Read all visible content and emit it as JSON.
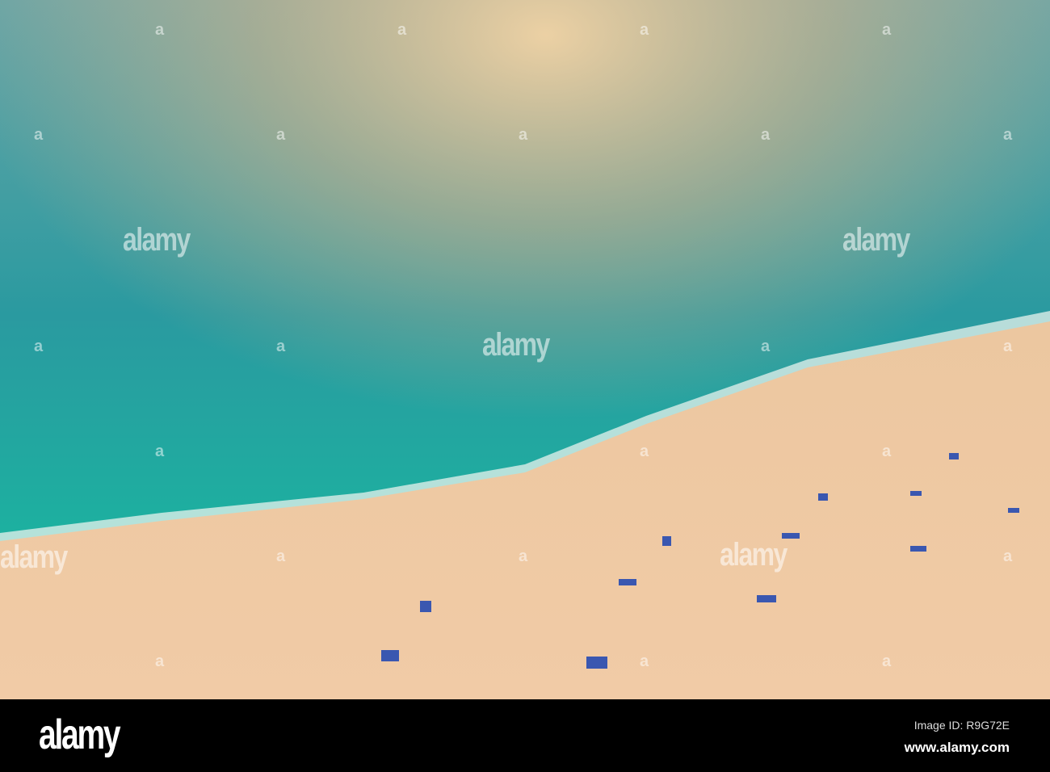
{
  "watermark": {
    "text": "alamy",
    "mark": "a"
  },
  "footer": {
    "logo": "alamy",
    "image_id": "Image ID: R9G72E",
    "website": "www.alamy.com"
  },
  "colors": {
    "sea_deep": "#1f8f9a",
    "sea_glow": "#e9bf8a",
    "sand": "#efc9a2",
    "chair": "#3a57b0"
  }
}
